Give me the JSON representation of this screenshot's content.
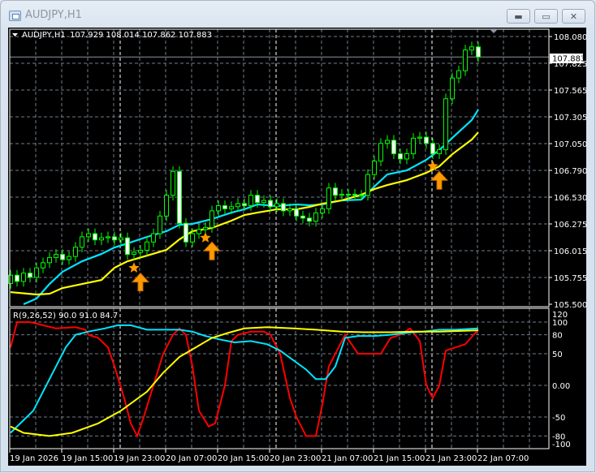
{
  "window": {
    "title": "AUDJPY,H1",
    "buttons": {
      "minimize": "▬",
      "restore": "▭",
      "close": "✕"
    }
  },
  "chart_data": {
    "type": "candlestick",
    "title": "AUDJPY,H1",
    "ohlc_header": "107.929 108.014 107.862 107.883",
    "last_price_label": "107.883",
    "last_price": 107.883,
    "ylim": [
      105.5,
      108.08
    ],
    "price_ticks": [
      "108.080",
      "107.825",
      "107.565",
      "107.305",
      "107.050",
      "106.790",
      "106.530",
      "106.275",
      "106.015",
      "105.755",
      "105.500"
    ],
    "time_labels": [
      "19 Jan 2026",
      "19 Jan 15:00",
      "19 Jan 23:00",
      "20 Jan 07:00",
      "20 Jan 15:00",
      "20 Jan 23:00",
      "21 Jan 07:00",
      "21 Jan 15:00",
      "21 Jan 23:00",
      "22 Jan 07:00"
    ],
    "colors": {
      "bull_outline": "#00ff00",
      "bear_fill": "#ffffff",
      "ma_fast": "#00e5ff",
      "ma_slow": "#ffff00",
      "signal": "#ff9900",
      "background": "#000000",
      "grid": "#708090"
    },
    "close": [
      105.78,
      105.72,
      105.8,
      105.76,
      105.85,
      105.9,
      105.95,
      105.98,
      105.93,
      105.96,
      106.05,
      106.15,
      106.18,
      106.12,
      106.14,
      106.15,
      106.12,
      106.14,
      105.98,
      106.0,
      106.02,
      106.1,
      106.18,
      106.35,
      106.55,
      106.78,
      106.28,
      106.1,
      106.18,
      106.22,
      106.24,
      106.4,
      106.45,
      106.42,
      106.44,
      106.47,
      106.45,
      106.55,
      106.48,
      106.5,
      106.44,
      106.47,
      106.4,
      106.42,
      106.35,
      106.33,
      106.3,
      106.38,
      106.42,
      106.62,
      106.55,
      106.56,
      106.56,
      106.55,
      106.55,
      106.75,
      106.88,
      107.05,
      107.08,
      106.95,
      106.9,
      106.95,
      107.1,
      107.11,
      107.05,
      106.95,
      106.99,
      107.48,
      107.68,
      107.75,
      107.95,
      107.98,
      107.883
    ],
    "open_first": 105.7,
    "ma_fast": {
      "bars": [
        2,
        4,
        6,
        8,
        11,
        14,
        16,
        18,
        21,
        24,
        26,
        28,
        31,
        34,
        36,
        38,
        41,
        44,
        46,
        48,
        51,
        54,
        56,
        58,
        61,
        64,
        66,
        68,
        71,
        72
      ],
      "values": [
        105.5,
        105.555,
        105.695,
        105.813,
        105.914,
        105.985,
        106.047,
        106.086,
        106.149,
        106.204,
        106.266,
        106.274,
        106.321,
        106.383,
        106.415,
        106.462,
        106.446,
        106.462,
        106.454,
        106.462,
        106.501,
        106.508,
        106.634,
        106.751,
        106.79,
        106.892,
        106.985,
        107.103,
        107.275,
        107.376
      ]
    },
    "ma_slow": {
      "bars": [
        0,
        4,
        6,
        8,
        11,
        14,
        16,
        18,
        21,
        24,
        26,
        28,
        31,
        34,
        36,
        38,
        41,
        44,
        46,
        48,
        51,
        54,
        56,
        58,
        61,
        64,
        66,
        68,
        71,
        72
      ],
      "values": [
        105.617,
        105.594,
        105.601,
        105.656,
        105.695,
        105.734,
        105.852,
        105.914,
        105.969,
        106.024,
        106.125,
        106.204,
        106.235,
        106.305,
        106.36,
        106.383,
        106.415,
        106.415,
        106.438,
        106.469,
        106.501,
        106.555,
        106.61,
        106.649,
        106.696,
        106.767,
        106.829,
        106.946,
        107.087,
        107.157
      ]
    },
    "signals": [
      {
        "star_bar": 19,
        "star_price": 105.85,
        "arrow_bar": 20,
        "arrow_price": 105.8
      },
      {
        "star_bar": 30,
        "star_price": 106.14,
        "arrow_bar": 31,
        "arrow_price": 106.1
      },
      {
        "star_bar": 65,
        "star_price": 106.83,
        "arrow_bar": 66,
        "arrow_price": 106.78
      }
    ],
    "indicator": {
      "label": "R(9,26,52) 90.0 91.0 84.7",
      "ticks": [
        "120",
        "100",
        "80",
        "50",
        "0.00",
        "-50",
        "-80",
        "-100"
      ],
      "tick_values": [
        120,
        100,
        80,
        50,
        0,
        -50,
        -80,
        -100
      ],
      "series": [
        {
          "name": "red",
          "color": "#ff0000",
          "points": [
            [
              0,
              60
            ],
            [
              1,
              100
            ],
            [
              3,
              100
            ],
            [
              5,
              95
            ],
            [
              7,
              90
            ],
            [
              10,
              92
            ],
            [
              11.5,
              88
            ],
            [
              12,
              80
            ],
            [
              13.5,
              75
            ],
            [
              15,
              60
            ],
            [
              16,
              30
            ],
            [
              17.5,
              -20
            ],
            [
              18.5,
              -60
            ],
            [
              19.5,
              -80
            ],
            [
              20.5,
              -50
            ],
            [
              22,
              0
            ],
            [
              23.5,
              50
            ],
            [
              25,
              80
            ],
            [
              26,
              90
            ],
            [
              27,
              80
            ],
            [
              28,
              30
            ],
            [
              29,
              -40
            ],
            [
              30.5,
              -65
            ],
            [
              31.5,
              -60
            ],
            [
              33,
              0
            ],
            [
              34,
              70
            ],
            [
              35,
              80
            ],
            [
              37,
              85
            ],
            [
              39,
              85
            ],
            [
              40,
              80
            ],
            [
              41.5,
              50
            ],
            [
              43,
              -20
            ],
            [
              44,
              -50
            ],
            [
              45.5,
              -80
            ],
            [
              47,
              -80
            ],
            [
              48,
              -30
            ],
            [
              49,
              30
            ],
            [
              50.5,
              60
            ],
            [
              51.5,
              80
            ],
            [
              53.5,
              50
            ],
            [
              55.5,
              50
            ],
            [
              57,
              50
            ],
            [
              58.5,
              75
            ],
            [
              60,
              80
            ],
            [
              61.5,
              90
            ],
            [
              63,
              70
            ],
            [
              64,
              0
            ],
            [
              65,
              -20
            ],
            [
              66,
              0
            ],
            [
              67,
              55
            ],
            [
              68.5,
              60
            ],
            [
              70,
              65
            ],
            [
              72,
              88
            ]
          ]
        },
        {
          "name": "cyan",
          "color": "#00e5ff",
          "points": [
            [
              0,
              -75
            ],
            [
              3.5,
              -40
            ],
            [
              6,
              10
            ],
            [
              8.5,
              60
            ],
            [
              10,
              80
            ],
            [
              12,
              85
            ],
            [
              14.5,
              90
            ],
            [
              16.5,
              95
            ],
            [
              18.5,
              95
            ],
            [
              21,
              88
            ],
            [
              23.5,
              88
            ],
            [
              26,
              88
            ],
            [
              28,
              85
            ],
            [
              30,
              78
            ],
            [
              32,
              73
            ],
            [
              34.5,
              68
            ],
            [
              37,
              70
            ],
            [
              39.5,
              65
            ],
            [
              41.5,
              55
            ],
            [
              43.5,
              40
            ],
            [
              45.5,
              25
            ],
            [
              47,
              10
            ],
            [
              48.5,
              10
            ],
            [
              50,
              30
            ],
            [
              51.5,
              75
            ],
            [
              53.5,
              78
            ],
            [
              56,
              78
            ],
            [
              58.5,
              80
            ],
            [
              61,
              83
            ],
            [
              63.5,
              85
            ],
            [
              66,
              88
            ],
            [
              68.5,
              88
            ],
            [
              72,
              90
            ]
          ]
        },
        {
          "name": "yellow",
          "color": "#ffff00",
          "points": [
            [
              0,
              -65
            ],
            [
              2,
              -75
            ],
            [
              6,
              -80
            ],
            [
              9.5,
              -75
            ],
            [
              13.5,
              -60
            ],
            [
              17,
              -40
            ],
            [
              21,
              -10
            ],
            [
              23.5,
              20
            ],
            [
              26,
              45
            ],
            [
              28.5,
              60
            ],
            [
              31,
              75
            ],
            [
              33.5,
              83
            ],
            [
              36,
              90
            ],
            [
              39.5,
              92
            ],
            [
              43.5,
              90
            ],
            [
              47,
              88
            ],
            [
              51,
              85
            ],
            [
              54.5,
              84
            ],
            [
              58.5,
              84
            ],
            [
              62,
              85
            ],
            [
              66,
              85
            ],
            [
              72,
              87
            ]
          ]
        }
      ]
    }
  }
}
